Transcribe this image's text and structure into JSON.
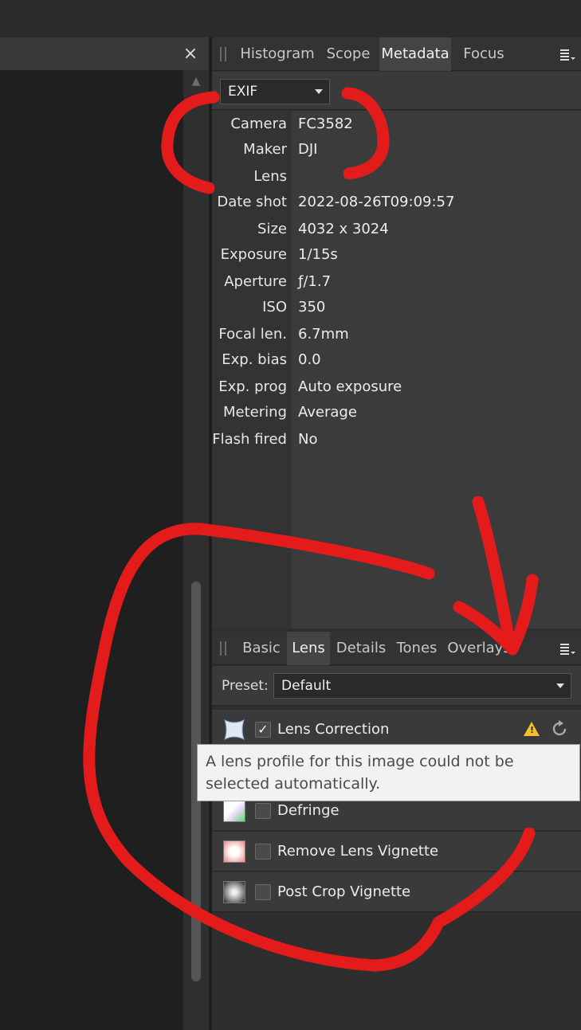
{
  "left_panel": {
    "close_glyph": "×"
  },
  "top_tabs": [
    {
      "label": "Histogram",
      "active": false
    },
    {
      "label": "Scope",
      "active": false
    },
    {
      "label": "Metadata",
      "active": true
    },
    {
      "label": "Focus",
      "active": false
    }
  ],
  "metadata": {
    "dropdown_value": "EXIF",
    "rows": [
      {
        "key": "Camera",
        "value": "FC3582"
      },
      {
        "key": "Maker",
        "value": "DJI"
      },
      {
        "key": "Lens",
        "value": ""
      },
      {
        "key": "Date shot",
        "value": "2022-08-26T09:09:57"
      },
      {
        "key": "Size",
        "value": "4032 x 3024"
      },
      {
        "key": "Exposure",
        "value": "1/15s"
      },
      {
        "key": "Aperture",
        "value": "ƒ/1.7"
      },
      {
        "key": "ISO",
        "value": "350"
      },
      {
        "key": "Focal len.",
        "value": "6.7mm"
      },
      {
        "key": "Exp. bias",
        "value": "0.0"
      },
      {
        "key": "Exp. prog",
        "value": "Auto exposure"
      },
      {
        "key": "Metering",
        "value": "Average"
      },
      {
        "key": "Flash fired",
        "value": "No"
      }
    ]
  },
  "bottom_tabs": [
    {
      "label": "Basic",
      "active": false
    },
    {
      "label": "Lens",
      "active": true
    },
    {
      "label": "Details",
      "active": false
    },
    {
      "label": "Tones",
      "active": false
    },
    {
      "label": "Overlays",
      "active": false
    }
  ],
  "lens_panel": {
    "preset_label": "Preset:",
    "preset_value": "Default",
    "items": [
      {
        "label": "Lens Correction",
        "checked": true,
        "icon": "lens-correction-icon"
      },
      {
        "label": "Defringe",
        "checked": false,
        "icon": "defringe-icon"
      },
      {
        "label": "Remove Lens Vignette",
        "checked": false,
        "icon": "remove-vignette-icon"
      },
      {
        "label": "Post Crop Vignette",
        "checked": false,
        "icon": "post-crop-vignette-icon"
      }
    ],
    "tooltip": "A lens profile for this image could not be selected automatically."
  },
  "colors": {
    "annotation_red": "#e41b1b",
    "warning_yellow": "#f2c12e"
  }
}
